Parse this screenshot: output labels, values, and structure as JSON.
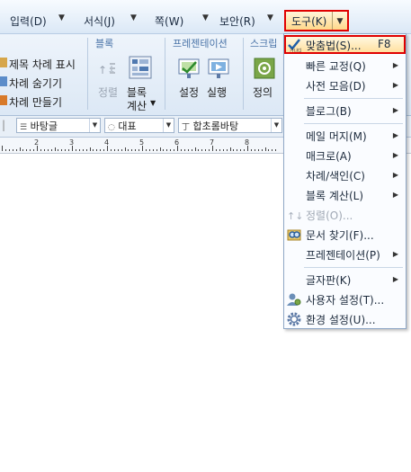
{
  "menubar": {
    "items": [
      "입력(D)",
      "서식(J)",
      "쪽(W)",
      "보안(R)",
      "도구(K)"
    ]
  },
  "ribbon": {
    "toc_items": [
      "제목 차례 표시",
      "차례 숨기기",
      "차례 만들기"
    ],
    "block_group": {
      "title": "블록",
      "sort": "정렬",
      "calc_line1": "블록",
      "calc_line2": "계산"
    },
    "presentation_group": {
      "title": "프레젠테이션",
      "setup": "설정",
      "run": "실행"
    },
    "script_group": {
      "title": "스크립",
      "define": "정의"
    }
  },
  "format_toolbar": {
    "style": "바탕글",
    "lang": "대표",
    "font": "합초롬바탕"
  },
  "ruler": {
    "numbers": [
      "2",
      "3",
      "4",
      "5",
      "6",
      "7",
      "8"
    ]
  },
  "tools_menu": {
    "items": [
      {
        "label": "맞춤법(S)...",
        "shortcut": "F8"
      },
      {
        "label": "빠른 교정(Q)"
      },
      {
        "label": "사전 모음(D)"
      },
      {
        "label": "블로그(B)"
      },
      {
        "label": "메일 머지(M)"
      },
      {
        "label": "매크로(A)"
      },
      {
        "label": "차례/색인(C)"
      },
      {
        "label": "블록 계산(L)"
      },
      {
        "label": "정렬(O)..."
      },
      {
        "label": "문서 찾기(F)..."
      },
      {
        "label": "프레젠테이션(P)"
      },
      {
        "label": "글자판(K)"
      },
      {
        "label": "사용자 설정(T)..."
      },
      {
        "label": "환경 설정(U)..."
      }
    ]
  },
  "colors": {
    "highlight_border": "#e00000",
    "menu_bg": "#fafcff",
    "ribbon_bg": "#dce8f5"
  }
}
